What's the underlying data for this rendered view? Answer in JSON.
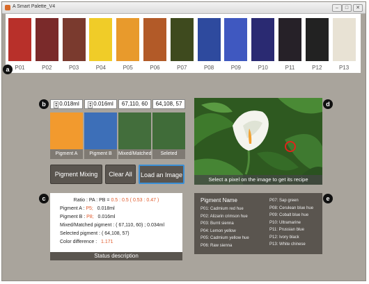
{
  "window": {
    "title": "A Smart Palette_V4",
    "controls": {
      "minimize": "–",
      "maximize": "□",
      "close": "✕"
    }
  },
  "palette": [
    {
      "label": "P01",
      "color": "#b8302a"
    },
    {
      "label": "P02",
      "color": "#7a2a2a"
    },
    {
      "label": "P03",
      "color": "#7a3a2e"
    },
    {
      "label": "P04",
      "color": "#f0cc28"
    },
    {
      "label": "P05",
      "color": "#e89a2c"
    },
    {
      "label": "P06",
      "color": "#b25a28"
    },
    {
      "label": "P07",
      "color": "#3e4a1e"
    },
    {
      "label": "P08",
      "color": "#2e4a9e"
    },
    {
      "label": "P09",
      "color": "#3f58c0"
    },
    {
      "label": "P10",
      "color": "#2a2a72"
    },
    {
      "label": "P11",
      "color": "#262128"
    },
    {
      "label": "P12",
      "color": "#222222"
    },
    {
      "label": "P13",
      "color": "#e8e2d4"
    }
  ],
  "badges": {
    "a": "a",
    "b": "b",
    "c": "c",
    "d": "d",
    "e": "e"
  },
  "mixer": {
    "amount_a": "0.018ml",
    "amount_b": "0.016ml",
    "mixed_rgb": "67,110, 60",
    "selected_rgb": "64,108, 57",
    "swatches": [
      {
        "label": "Pigment A",
        "color": "#f29a2e"
      },
      {
        "label": "Pigment B",
        "color": "#3d6fb8"
      },
      {
        "label": "Mixed/Matched",
        "color": "#436e3c"
      },
      {
        "label": "Seleted",
        "color": "#406c39"
      }
    ]
  },
  "buttons": {
    "mix": "Pigment Mixing",
    "clear": "Clear All",
    "load": "Load an Image"
  },
  "status": {
    "ratio_label": "Ratio : PA : PB =",
    "ratio_value": "0.5 : 0.5 ( 0.53 : 0.47 )",
    "pig_a_label": "Pigment A :",
    "pig_a_code": "P5;",
    "pig_a_amount": "0.018ml",
    "pig_b_label": "Pigment B :",
    "pig_b_code": "P8;",
    "pig_b_amount": "0.016ml",
    "mixed_label": "Mixed/Matched pigment :",
    "mixed_value": "( 67,110, 60) ; 0.034ml",
    "selected_label": "Selected pigment :",
    "selected_value": "( 64,108, 57)",
    "diff_label": "Color difference :",
    "diff_value": "1.171",
    "footer": "Status description"
  },
  "image_panel": {
    "caption": "Select a pixel on the image to get its recipe"
  },
  "legend": {
    "header": "Pigment Name",
    "left": [
      "P01: Cadmium red hue",
      "P02: Alizarin crimson hue",
      "P03: Burnt sienna",
      "P04: Lemon yellow",
      "P05: Cadmium yellow hue",
      "P06: Raw sienna"
    ],
    "right": [
      "P07: Sap green",
      "P08: Cerulean blue hue",
      "P09: Cobalt blue hue",
      "P10: Ultramarine",
      "P11: Prussian blue",
      "P12: Ivory black",
      "P13: White chinese"
    ]
  }
}
